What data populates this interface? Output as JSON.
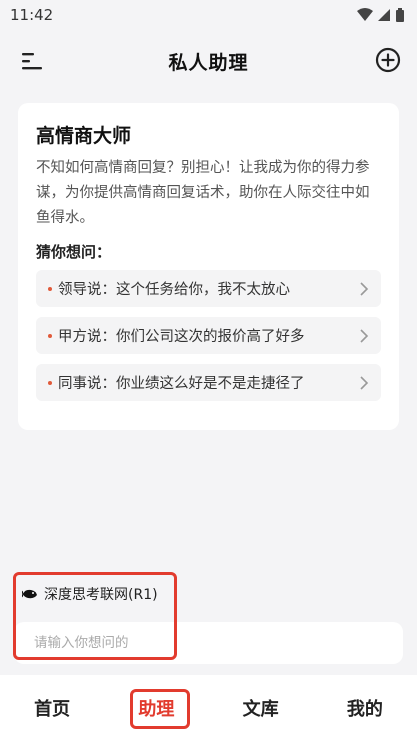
{
  "status_bar": {
    "time": "11:42"
  },
  "header": {
    "title": "私人助理"
  },
  "card": {
    "title": "高情商大师",
    "description": "不知如何高情商回复？别担心！让我成为你的得力参谋，为你提供高情商回复话术，助你在人际交往中如鱼得水。",
    "guess_label": "猜你想问：",
    "suggestions": [
      {
        "text": "领导说：这个任务给你，我不太放心"
      },
      {
        "text": "甲方说：你们公司这次的报价高了好多"
      },
      {
        "text": "同事说：你业绩这么好是不是走捷径了"
      }
    ]
  },
  "input": {
    "deep_think_label": "深度思考联网(R1)",
    "placeholder": "请输入你想问的",
    "value": ""
  },
  "bottom_nav": {
    "items": [
      {
        "label": "首页"
      },
      {
        "label": "助理"
      },
      {
        "label": "文库"
      },
      {
        "label": "我的"
      }
    ],
    "active_index": 1
  },
  "colors": {
    "accent": "#e23b2e",
    "bullet": "#e05a3a",
    "background": "#f4f4f6"
  }
}
